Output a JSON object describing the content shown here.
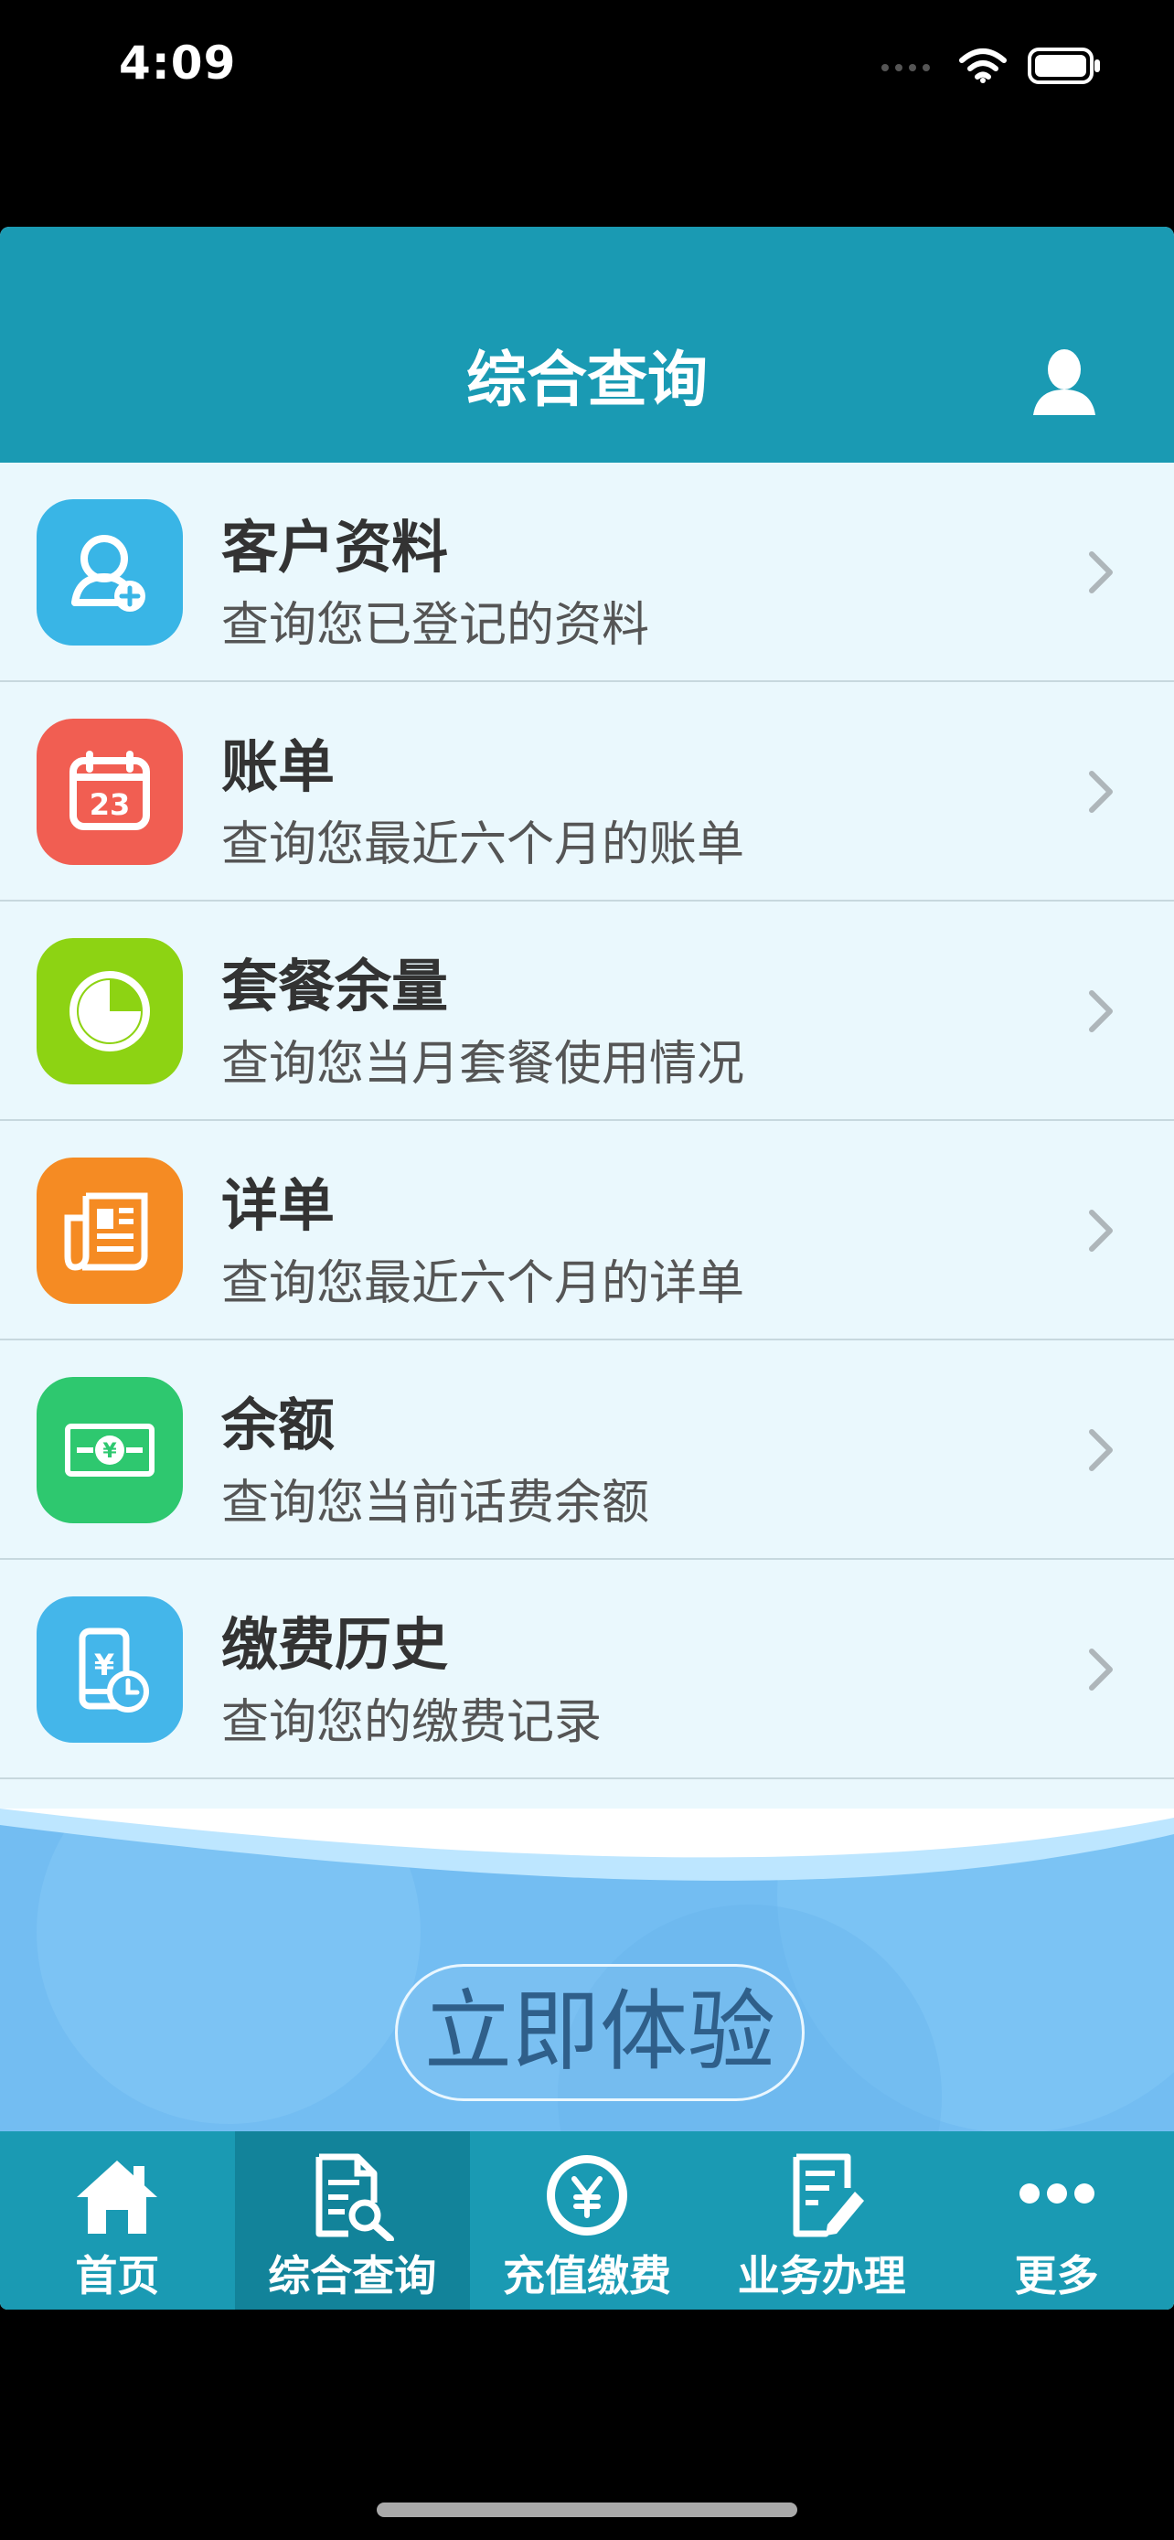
{
  "status_bar": {
    "time": "4:09",
    "icons": [
      "signal-icon",
      "wifi-icon",
      "battery-icon"
    ]
  },
  "header": {
    "title": "综合查询",
    "profile_icon": "user-icon"
  },
  "menu": [
    {
      "title": "客户资料",
      "subtitle": "查询您已登记的资料",
      "icon": "customer-profile-icon",
      "color": "#39b5e6"
    },
    {
      "title": "账单",
      "subtitle": "查询您最近六个月的账单",
      "icon": "calendar-icon",
      "color": "#f15e52"
    },
    {
      "title": "套餐余量",
      "subtitle": "查询您当月套餐使用情况",
      "icon": "pie-chart-icon",
      "color": "#8dd313"
    },
    {
      "title": "详单",
      "subtitle": "查询您最近六个月的详单",
      "icon": "document-list-icon",
      "color": "#f58b23"
    },
    {
      "title": "余额",
      "subtitle": "查询您当前话费余额",
      "icon": "money-icon",
      "color": "#2ec86f"
    },
    {
      "title": "缴费历史",
      "subtitle": "查询您的缴费记录",
      "icon": "phone-payment-icon",
      "color": "#44b6ea"
    }
  ],
  "calendar_day": "23",
  "currency_symbol": "¥",
  "banner": {
    "cta_label": "立即体验",
    "background_color": "#73bdf2"
  },
  "tabs": [
    {
      "label": "首页",
      "icon": "home-icon",
      "active": false
    },
    {
      "label": "综合查询",
      "icon": "search-document-icon",
      "active": true
    },
    {
      "label": "充值缴费",
      "icon": "yuan-coin-icon",
      "active": false
    },
    {
      "label": "业务办理",
      "icon": "edit-document-icon",
      "active": false
    },
    {
      "label": "更多",
      "icon": "more-icon",
      "active": false
    }
  ],
  "colors": {
    "primary": "#1a9ab3",
    "active_tab": "#12839a",
    "list_background": "#eaf8fd"
  }
}
